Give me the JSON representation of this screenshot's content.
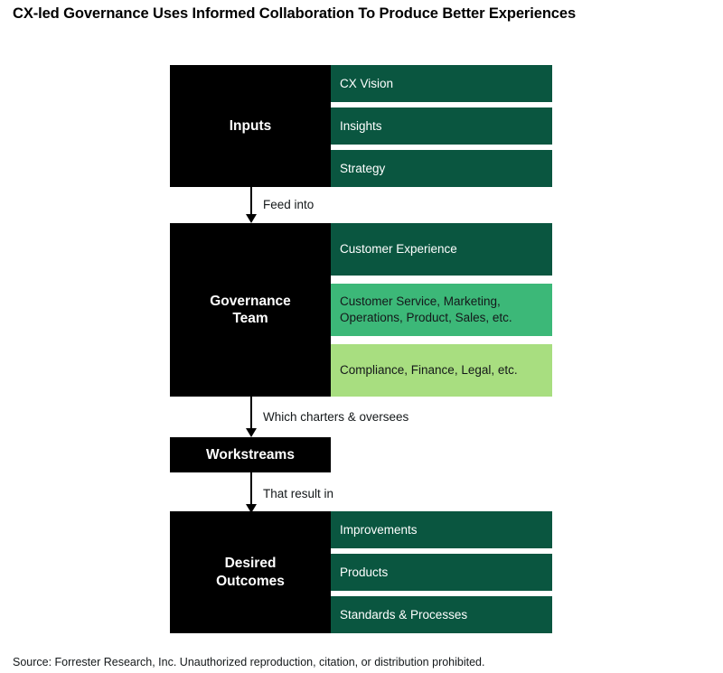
{
  "title": "CX-led Governance Uses Informed Collaboration To Produce Better Experiences",
  "source_note": "Source: Forrester Research, Inc. Unauthorized reproduction, citation, or distribution prohibited.",
  "colors": {
    "black": "#000000",
    "green_dark": "#0a5640",
    "green_mid": "#3cb878",
    "green_light": "#a8de80",
    "text_light": "#ffffff",
    "text_dark": "#14181a",
    "background": "#ffffff"
  },
  "stages": {
    "inputs": {
      "label": "Inputs",
      "rows": [
        {
          "text": "CX Vision",
          "tone": "dark"
        },
        {
          "text": "Insights",
          "tone": "dark"
        },
        {
          "text": "Strategy",
          "tone": "dark"
        }
      ]
    },
    "governance_team": {
      "label": "Governance Team",
      "label_line1": "Governance",
      "label_line2": "Team",
      "rows": [
        {
          "text": "Customer Experience",
          "tone": "dark"
        },
        {
          "text": "Customer Service, Marketing, Operations, Product, Sales, etc.",
          "tone": "mid"
        },
        {
          "text": "Compliance, Finance, Legal, etc.",
          "tone": "light"
        }
      ]
    },
    "workstreams": {
      "label": "Workstreams"
    },
    "desired_outcomes": {
      "label": "Desired Outcomes",
      "label_line1": "Desired",
      "label_line2": "Outcomes",
      "rows": [
        {
          "text": "Improvements",
          "tone": "dark"
        },
        {
          "text": "Products",
          "tone": "dark"
        },
        {
          "text": "Standards & Processes",
          "tone": "dark"
        }
      ]
    }
  },
  "connectors": [
    {
      "label": "Feed into",
      "from": "inputs",
      "to": "governance_team"
    },
    {
      "label": "Which charters & oversees",
      "from": "governance_team",
      "to": "workstreams"
    },
    {
      "label": "That result in",
      "from": "workstreams",
      "to": "desired_outcomes"
    }
  ]
}
